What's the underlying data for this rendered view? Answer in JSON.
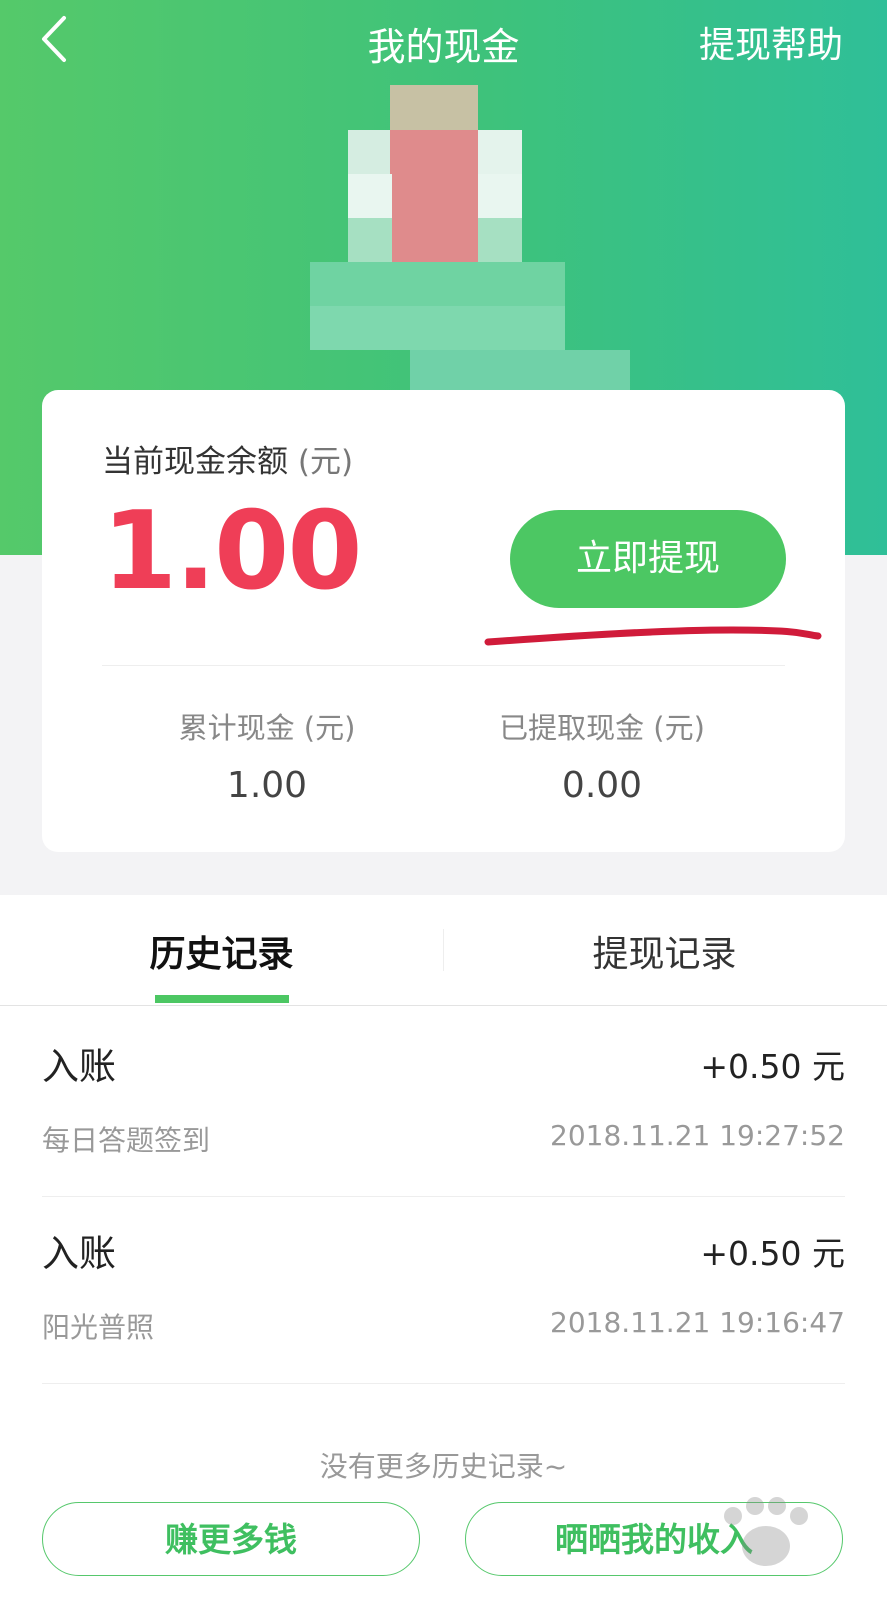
{
  "nav": {
    "title": "我的现金",
    "help": "提现帮助"
  },
  "balance": {
    "label": "当前现金余额",
    "unit": "(元)",
    "value": "1.00",
    "withdraw_button": "立即提现"
  },
  "stats": [
    {
      "label": "累计现金 (元)",
      "value": "1.00"
    },
    {
      "label": "已提取现金 (元)",
      "value": "0.00"
    }
  ],
  "tabs": [
    {
      "label": "历史记录",
      "active": true
    },
    {
      "label": "提现记录",
      "active": false
    }
  ],
  "records": [
    {
      "type": "入账",
      "desc": "每日答题签到",
      "amount": "+0.50 元",
      "time": "2018.11.21 19:27:52"
    },
    {
      "type": "入账",
      "desc": "阳光普照",
      "amount": "+0.50 元",
      "time": "2018.11.21 19:16:47"
    }
  ],
  "no_more": "没有更多历史记录~",
  "bottom": {
    "earn_more": "赚更多钱",
    "share_income": "晒晒我的收入"
  },
  "colors": {
    "brand_green": "#4cc763",
    "balance_red": "#ef3e57",
    "annotation_red": "#d01b3a"
  }
}
